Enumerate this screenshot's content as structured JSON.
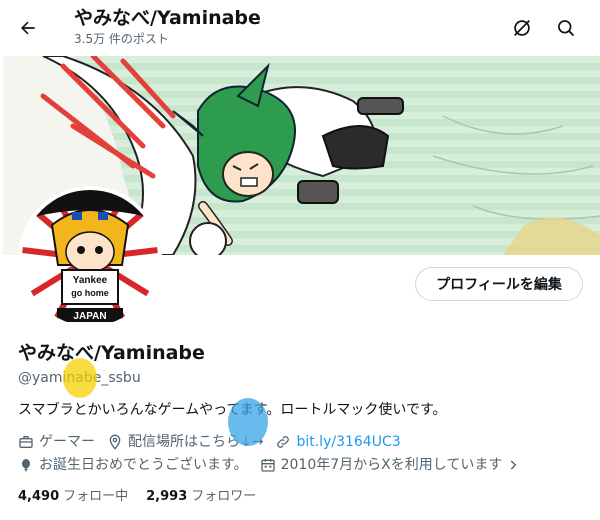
{
  "header": {
    "title": "やみなべ/Yaminabe",
    "posts_count": "3.5万 件のポスト"
  },
  "icons": {
    "back": "arrow-left-icon",
    "hide": "hide-icon",
    "search": "search-icon"
  },
  "profile": {
    "display_name": "やみなべ/Yaminabe",
    "handle": "@yaminabe_ssbu",
    "bio": "スマブラとかいろんなゲームやってます。ロートルマック使いです。",
    "edit_button": "プロフィールを編集",
    "avatar_text_top": "Yankee",
    "avatar_text_bottom": "go home",
    "avatar_text_japan": "JAPAN"
  },
  "meta": {
    "category": "ゲーマー",
    "location": "配信場所はこちら↓→",
    "link": "bit.ly/3164UC3",
    "birthday": "お誕生日おめでとうございます。",
    "joined": "2010年7月からXを利用しています"
  },
  "follow": {
    "following_count": "4,490",
    "following_label": "フォロー中",
    "followers_count": "2,993",
    "followers_label": "フォロワー"
  },
  "colors": {
    "accent": "#1d9bf0",
    "text": "#0f1419",
    "muted": "#536471",
    "border": "#cfd9de"
  }
}
